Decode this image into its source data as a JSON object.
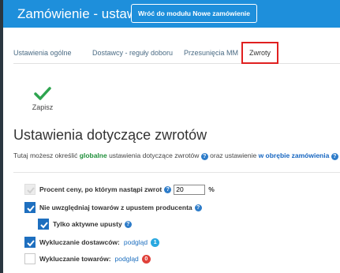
{
  "header": {
    "title": "Zamówienie - ustawienia",
    "back_label": "Wróć do modułu Nowe zamówienie"
  },
  "tabs": [
    {
      "label": "Ustawienia ogólne",
      "active": false
    },
    {
      "label": "Dostawcy - reguły doboru",
      "active": false
    },
    {
      "label": "Przesunięcia MM",
      "active": false
    },
    {
      "label": "Zwroty",
      "active": true
    }
  ],
  "toolbar": {
    "save_label": "Zapisz"
  },
  "section": {
    "title": "Ustawienia dotyczące zwrotów",
    "desc_part1": "Tutaj możesz określić ",
    "desc_global": "globalne",
    "desc_part2": " ustawienia dotyczące zwrotów ",
    "desc_part3": " oraz ustawienie ",
    "desc_order": "w obrębie zamówienia"
  },
  "settings": {
    "price_percent": {
      "label": "Procent ceny, po którym nastąpi zwrot",
      "value": "20",
      "unit": "%",
      "checked": true,
      "disabled": true
    },
    "ignore_discount": {
      "label": "Nie uwzględniaj towarów z upustem producenta",
      "checked": true
    },
    "only_active": {
      "label": "Tylko aktywne upusty",
      "checked": true
    },
    "exclude_suppliers": {
      "label": "Wykluczanie dostawców:",
      "link": "podgląd",
      "count": "1",
      "checked": true
    },
    "exclude_products": {
      "label": "Wykluczanie towarów:",
      "link": "podgląd",
      "count": "0",
      "checked": false
    }
  },
  "colors": {
    "header": "#1e8fdb",
    "checkbox": "#1e6fbf",
    "badge_blue": "#29a8e0",
    "badge_red": "#e0413a",
    "save_green": "#2ea44f"
  }
}
